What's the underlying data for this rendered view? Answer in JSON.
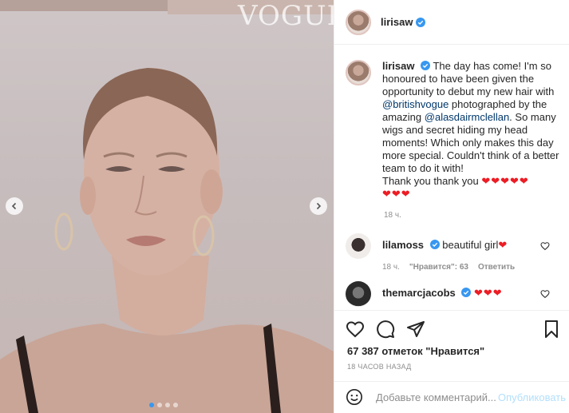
{
  "media": {
    "watermark": "VOGUE",
    "carousel_dots": 4,
    "active_dot": 0
  },
  "header": {
    "username": "lirisaw"
  },
  "caption": {
    "username": "lirisaw",
    "text_before_mention": "The day has come! I'm so honoured to have been given the opportunity to debut my new hair with",
    "mention1": "@britishvogue",
    "text_between": "photographed by the amazing",
    "mention2": "@alasdairmclellan",
    "text_after": ". So many wigs and secret hiding my head moments! Which only makes this day more special. Couldn't think of a better team to do it with!",
    "line_last": "Thank you thank you",
    "hearts_line1": "❤❤❤❤❤",
    "hearts_line2": "❤❤❤",
    "time": "18 ч."
  },
  "comments": [
    {
      "username": "lilamoss",
      "text": "beautiful girl",
      "hearts": "❤",
      "time": "18 ч.",
      "likes": "\"Нравится\": 63",
      "reply": "Ответить"
    },
    {
      "username": "themarcjacobs",
      "text": "",
      "hearts": "❤❤❤"
    }
  ],
  "likes_text": "67 387 отметок \"Нравится\"",
  "posted_ago": "18 ЧАСОВ НАЗАД",
  "add_comment": {
    "placeholder": "Добавьте комментарий...",
    "publish": "Опубликовать"
  },
  "colors": {
    "accent": "#3897f0",
    "heart": "#ed1c24",
    "link": "#00376b",
    "muted": "#8e8e8e"
  }
}
